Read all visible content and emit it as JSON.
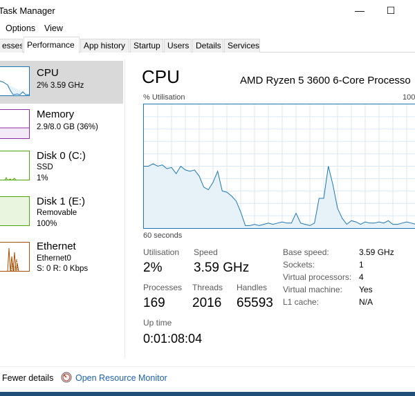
{
  "window": {
    "title": "Task Manager",
    "minimize": "—",
    "maximize": "☐"
  },
  "menu": {
    "options": "Options",
    "view": "View"
  },
  "tabs": [
    {
      "label": "esses"
    },
    {
      "label": "Performance"
    },
    {
      "label": "App history"
    },
    {
      "label": "Startup"
    },
    {
      "label": "Users"
    },
    {
      "label": "Details"
    },
    {
      "label": "Services"
    }
  ],
  "sidebar": {
    "items": [
      {
        "name": "CPU",
        "sub1": "2% 3.59 GHz",
        "sub2": "",
        "sub3": ""
      },
      {
        "name": "Memory",
        "sub1": "2.9/8.0 GB (36%)",
        "sub2": "",
        "sub3": ""
      },
      {
        "name": "Disk 0 (C:)",
        "sub1": "SSD",
        "sub2": "1%",
        "sub3": ""
      },
      {
        "name": "Disk 1 (E:)",
        "sub1": "Removable",
        "sub2": "100%",
        "sub3": ""
      },
      {
        "name": "Ethernet",
        "sub1": "Ethernet0",
        "sub2": "S: 0 R: 0 Kbps",
        "sub3": ""
      }
    ]
  },
  "main": {
    "title": "CPU",
    "model": "AMD Ryzen 5 3600 6-Core Processo",
    "graph_label_left": "% Utilisation",
    "graph_label_right": "100",
    "graph_time": "60 seconds",
    "utilisation_label": "Utilisation",
    "utilisation_value": "2%",
    "speed_label": "Speed",
    "speed_value": "3.59 GHz",
    "processes_label": "Processes",
    "processes_value": "169",
    "threads_label": "Threads",
    "threads_value": "2016",
    "handles_label": "Handles",
    "handles_value": "65593",
    "uptime_label": "Up time",
    "uptime_value": "0:01:08:04",
    "specs": [
      {
        "label": "Base speed:",
        "value": "3.59 GHz"
      },
      {
        "label": "Sockets:",
        "value": "1"
      },
      {
        "label": "Virtual processors:",
        "value": "4"
      },
      {
        "label": "Virtual machine:",
        "value": "Yes"
      },
      {
        "label": "L1 cache:",
        "value": "N/A"
      }
    ]
  },
  "chart_data": {
    "type": "area",
    "ylim": [
      0,
      100
    ],
    "values": [
      50,
      50,
      52,
      50,
      51,
      48,
      49,
      44,
      50,
      47,
      46,
      47,
      42,
      33,
      31,
      37,
      46,
      30,
      29,
      26,
      22,
      13,
      2,
      2,
      3,
      2,
      3,
      4,
      3,
      4,
      5,
      4,
      4,
      12,
      4,
      3,
      2,
      4,
      24,
      24,
      50,
      35,
      16,
      8,
      3,
      6,
      5,
      3,
      5,
      4,
      4,
      5,
      4,
      6,
      3,
      3,
      4,
      5,
      4,
      3,
      3
    ]
  },
  "footer": {
    "fewer_details": "Fewer details",
    "resource_monitor": "Open Resource Monitor"
  },
  "colors": {
    "cpu": "#1a77b5",
    "memory": "#8b2aa7",
    "disk": "#4ca800",
    "ethernet": "#a74f01"
  }
}
